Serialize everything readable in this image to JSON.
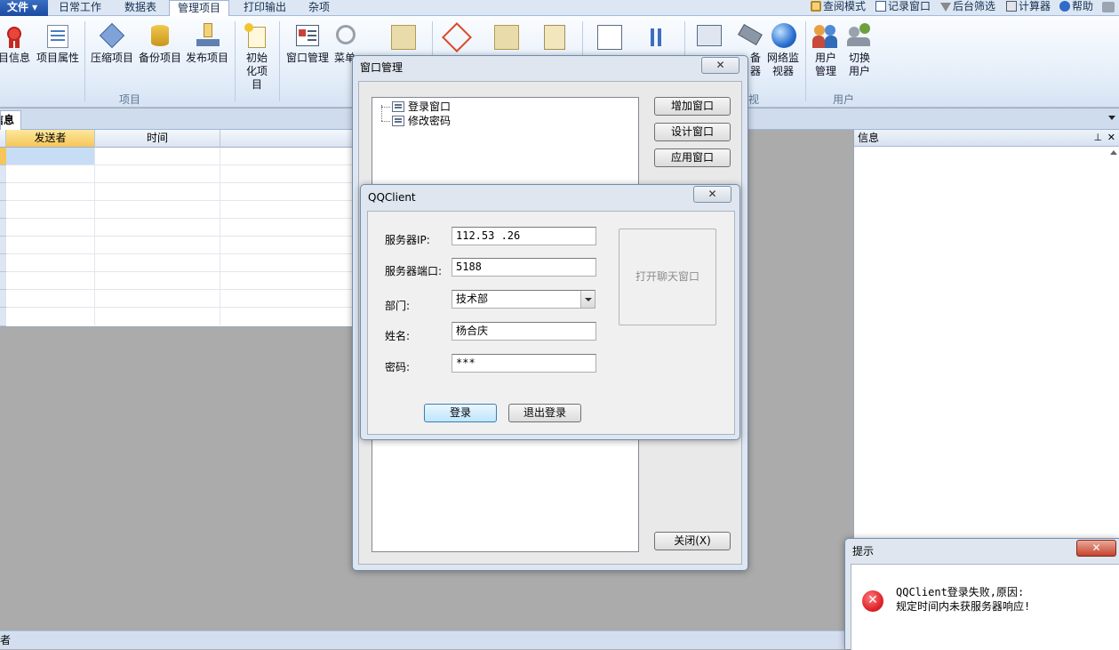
{
  "menu": {
    "file_label": "文件 ▾",
    "tabs": [
      "日常工作",
      "数据表",
      "管理项目",
      "打印输出",
      "杂项"
    ],
    "active_tab": "管理项目",
    "right_tools": [
      "查阅模式",
      "记录窗口",
      "后台筛选",
      "计算器",
      "帮助"
    ]
  },
  "ribbon": {
    "buttons": [
      {
        "label": "目信息"
      },
      {
        "label": "项目属性"
      },
      {
        "label": "压缩项目"
      },
      {
        "label": "备份项目"
      },
      {
        "label": "发布项目"
      },
      {
        "label": "初始化项目"
      },
      {
        "label": "窗口管理"
      },
      {
        "label": "菜单"
      },
      {
        "label": "备器"
      },
      {
        "label": "网络监视器"
      },
      {
        "label": "用户管理"
      },
      {
        "label": "切换用户"
      }
    ],
    "groups": [
      "项目",
      "视",
      "用户"
    ]
  },
  "doc_tab": "信息",
  "grid": {
    "columns": [
      "发送者",
      "时间"
    ]
  },
  "info_panel": {
    "title": "信息",
    "pin": "⊥",
    "close": "✕"
  },
  "statusbar": {
    "text": "者"
  },
  "window_manager": {
    "title": "窗口管理",
    "close": "✕",
    "tree": [
      "登录窗口",
      "修改密码"
    ],
    "buttons": {
      "add": "增加窗口",
      "design": "设计窗口",
      "apply": "应用窗口",
      "close": "关闭(X)"
    }
  },
  "qqclient": {
    "title": "QQClient",
    "close": "✕",
    "fields": [
      {
        "label": "服务器IP:",
        "value": "112.53     .26"
      },
      {
        "label": "服务器端口:",
        "value": "5188"
      },
      {
        "label": "部门:",
        "value": "技术部"
      },
      {
        "label": "姓名:",
        "value": "杨合庆"
      },
      {
        "label": "密码:",
        "value": "***"
      }
    ],
    "open_chat": "打开聊天窗口",
    "login": "登录",
    "logout": "退出登录"
  },
  "alert": {
    "title": "提示",
    "close": "✕",
    "message_line1": "QQClient登录失败,原因:",
    "message_line2": "规定时间内未获服务器响应!"
  },
  "colors": {
    "accent": "#1b4aa0",
    "error": "#e0262d",
    "header_selected": "#f6c65a",
    "row_selected": "#c7dcf5"
  }
}
